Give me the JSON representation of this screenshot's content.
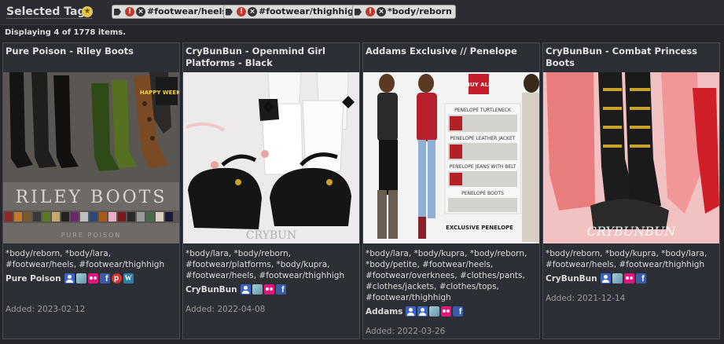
{
  "tagbar": {
    "title": "Selected Tags",
    "tags": [
      "#footwear/heels",
      "#footwear/thighhigh",
      "*body/reborn"
    ]
  },
  "status": "Displaying 4 of 1778 items.",
  "items": [
    {
      "title": "Pure Poison - Riley Boots",
      "image_text": "RILEY BOOTS",
      "image_subtext": "PURE POISON",
      "image_badge": "HAPPY WEEKEND",
      "tags": "*body/reborn, *body/lara, #footwear/heels, #footwear/thighhigh",
      "source": "Pure Poison",
      "icons": [
        "user-icon",
        "marketplace-icon",
        "flickr-icon",
        "facebook-icon",
        "pinterest-icon",
        "wordpress-icon"
      ],
      "added": "Added: 2023-02-12"
    },
    {
      "title": "CryBunBun - Openmind Girl Platforms - Black",
      "tags": "*body/lara, *body/reborn, #footwear/platforms, *body/kupra, #footwear/heels, #footwear/thighhigh",
      "source": "CryBunBun",
      "icons": [
        "user-icon",
        "marketplace-icon",
        "flickr-icon",
        "facebook-icon"
      ],
      "added": "Added: 2022-04-08"
    },
    {
      "title": "Addams Exclusive // Penelope",
      "image_badge": "BUY ALL",
      "image_labels": [
        "PENELOPE TURTLENECK",
        "PENELOPE LEATHER JACKET",
        "PENELOPE JEANS WITH BELT",
        "PENELOPE BOOTS",
        "EXCLUSIVE PENELOPE"
      ],
      "tags": "*body/lara, *body/kupra, *body/reborn, *body/petite, #footwear/heels, #footwear/overknees, #clothes/pants, #clothes/jackets, #clothes/tops, #footwear/thighhigh",
      "source": "Addams",
      "icons": [
        "user-icon",
        "user-icon",
        "marketplace-icon",
        "flickr-icon",
        "facebook-icon"
      ],
      "added": "Added: 2022-03-26"
    },
    {
      "title": "CryBunBun - Combat Princess Boots",
      "image_text": "CRYBUNBUN",
      "tags": "*body/reborn, *body/kupra, *body/lara, #footwear/heels, #footwear/thighhigh",
      "source": "CryBunBun",
      "icons": [
        "user-icon",
        "marketplace-icon",
        "flickr-icon",
        "facebook-icon"
      ],
      "added": "Added: 2021-12-14"
    }
  ],
  "colors": {
    "background": "#24262b",
    "card": "#2c2f35",
    "card_border": "#484c55",
    "chip": "#dcdcdc",
    "muted_text": "#9c9c9c"
  }
}
